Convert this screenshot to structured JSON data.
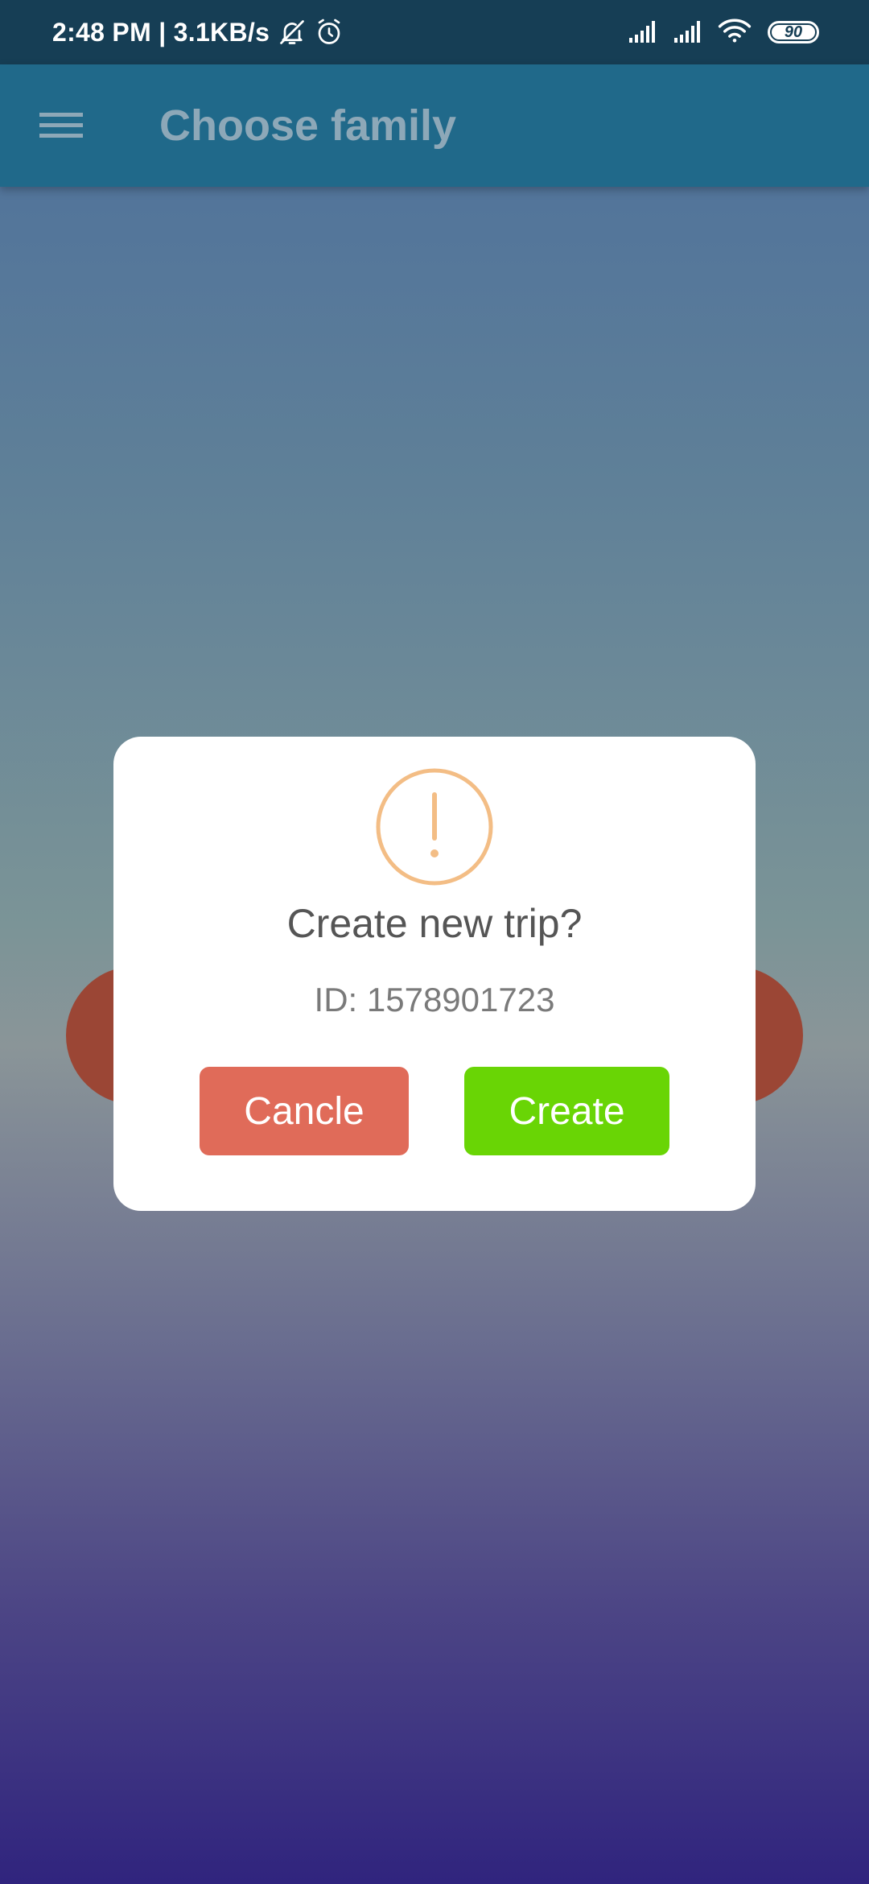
{
  "status_bar": {
    "time_speed": "2:48 PM | 3.1KB/s",
    "battery_level": "90",
    "icons": [
      "bell-off-icon",
      "alarm-icon",
      "signal-icon",
      "signal-icon",
      "wifi-icon",
      "battery-icon"
    ]
  },
  "app_bar": {
    "title": "Choose family",
    "menu_icon": "hamburger-menu-icon"
  },
  "dialog": {
    "icon": "exclamation-icon",
    "title": "Create new trip?",
    "id_text": "ID: 1578901723",
    "cancel_label": "Cancle",
    "create_label": "Create"
  },
  "colors": {
    "status_bar": "#163e55",
    "app_bar": "#20698a",
    "title_text": "#8da8b8",
    "warning_icon": "#f3bd85",
    "cancel_button": "#e06b59",
    "create_button": "#69d505",
    "background_blob": "#9b4635"
  }
}
